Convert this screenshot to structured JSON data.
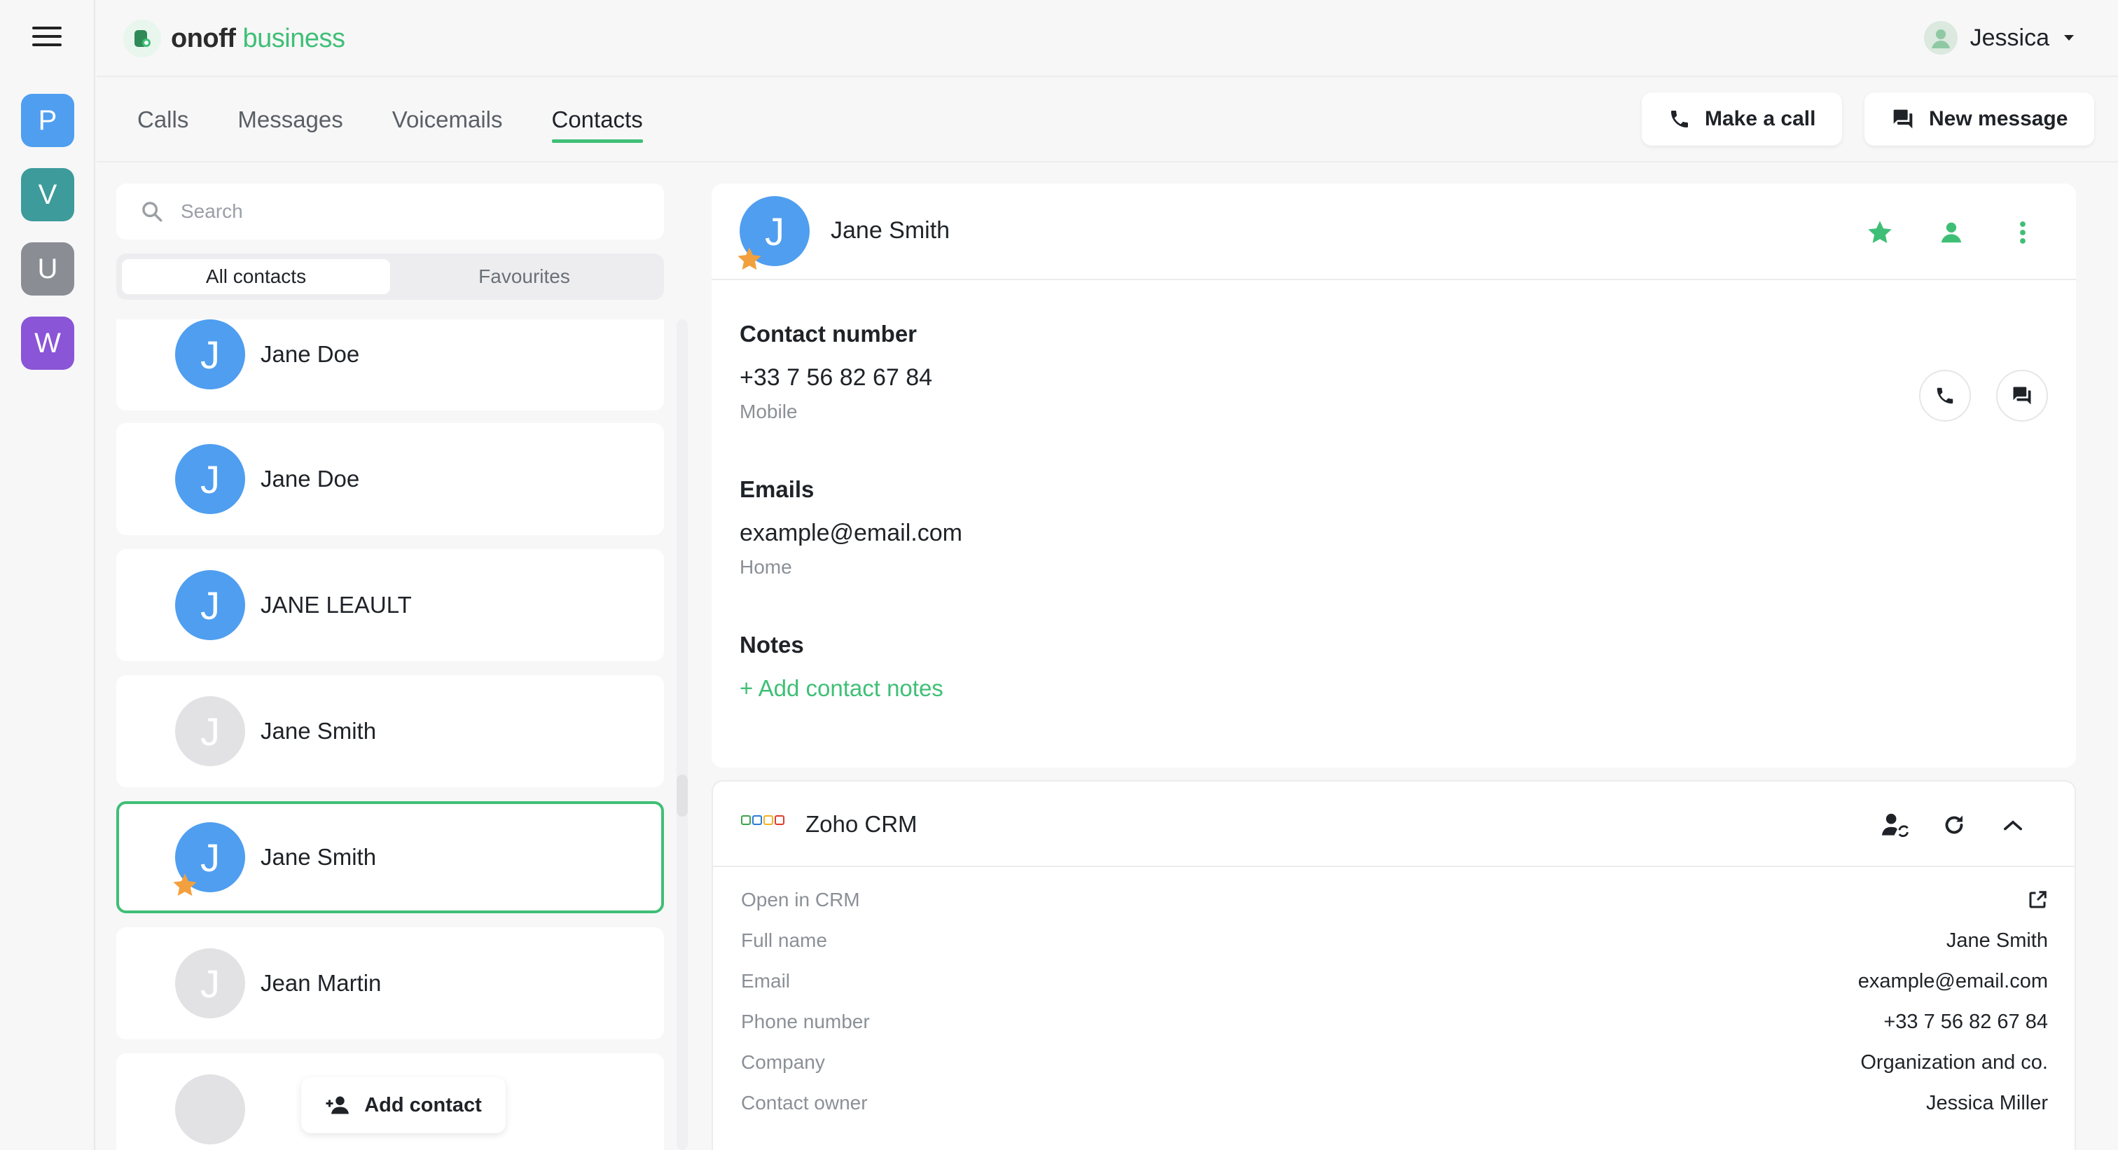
{
  "workspaces": [
    {
      "letter": "P",
      "color": "#4f9ef0"
    },
    {
      "letter": "V",
      "color": "#3d9b9b"
    },
    {
      "letter": "U",
      "color": "#8a8d93"
    },
    {
      "letter": "W",
      "color": "#8a55d6"
    }
  ],
  "brand": {
    "name": "onoff",
    "suffix": " business",
    "accent": "#3fbf76"
  },
  "user": {
    "name": "Jessica"
  },
  "nav": {
    "tabs": [
      "Calls",
      "Messages",
      "Voicemails",
      "Contacts"
    ],
    "active_tab": "Contacts",
    "make_call_label": "Make a call",
    "new_message_label": "New message"
  },
  "search": {
    "placeholder": "Search"
  },
  "filters": {
    "all_label": "All contacts",
    "favourites_label": "Favourites",
    "active": "All contacts"
  },
  "contacts": [
    {
      "name": "Jane Doe",
      "initial": "J",
      "avatar": "blue",
      "favourite": false,
      "selected": false
    },
    {
      "name": "Jane Doe",
      "initial": "J",
      "avatar": "blue",
      "favourite": false,
      "selected": false
    },
    {
      "name": "JANE LEAULT",
      "initial": "J",
      "avatar": "blue",
      "favourite": false,
      "selected": false
    },
    {
      "name": "Jane Smith",
      "initial": "J",
      "avatar": "grey",
      "favourite": false,
      "selected": false
    },
    {
      "name": "Jane Smith",
      "initial": "J",
      "avatar": "blue",
      "favourite": true,
      "selected": true
    },
    {
      "name": "Jean Martin",
      "initial": "J",
      "avatar": "grey",
      "favourite": false,
      "selected": false
    }
  ],
  "add_contact_label": "Add contact",
  "detail": {
    "name": "Jane Smith",
    "initial": "J",
    "contact_number_title": "Contact number",
    "phone": "+33 7 56 82 67 84",
    "phone_type": "Mobile",
    "emails_title": "Emails",
    "email": "example@email.com",
    "email_type": "Home",
    "notes_title": "Notes",
    "add_notes_label": "+ Add contact notes"
  },
  "crm": {
    "title": "Zoho CRM",
    "open_label": "Open in CRM",
    "rows": [
      {
        "label": "Full name",
        "value": "Jane Smith"
      },
      {
        "label": "Email",
        "value": "example@email.com"
      },
      {
        "label": "Phone number",
        "value": "+33 7 56 82 67 84"
      },
      {
        "label": "Company",
        "value": "Organization and co."
      },
      {
        "label": "Contact owner",
        "value": "Jessica Miller"
      }
    ]
  }
}
